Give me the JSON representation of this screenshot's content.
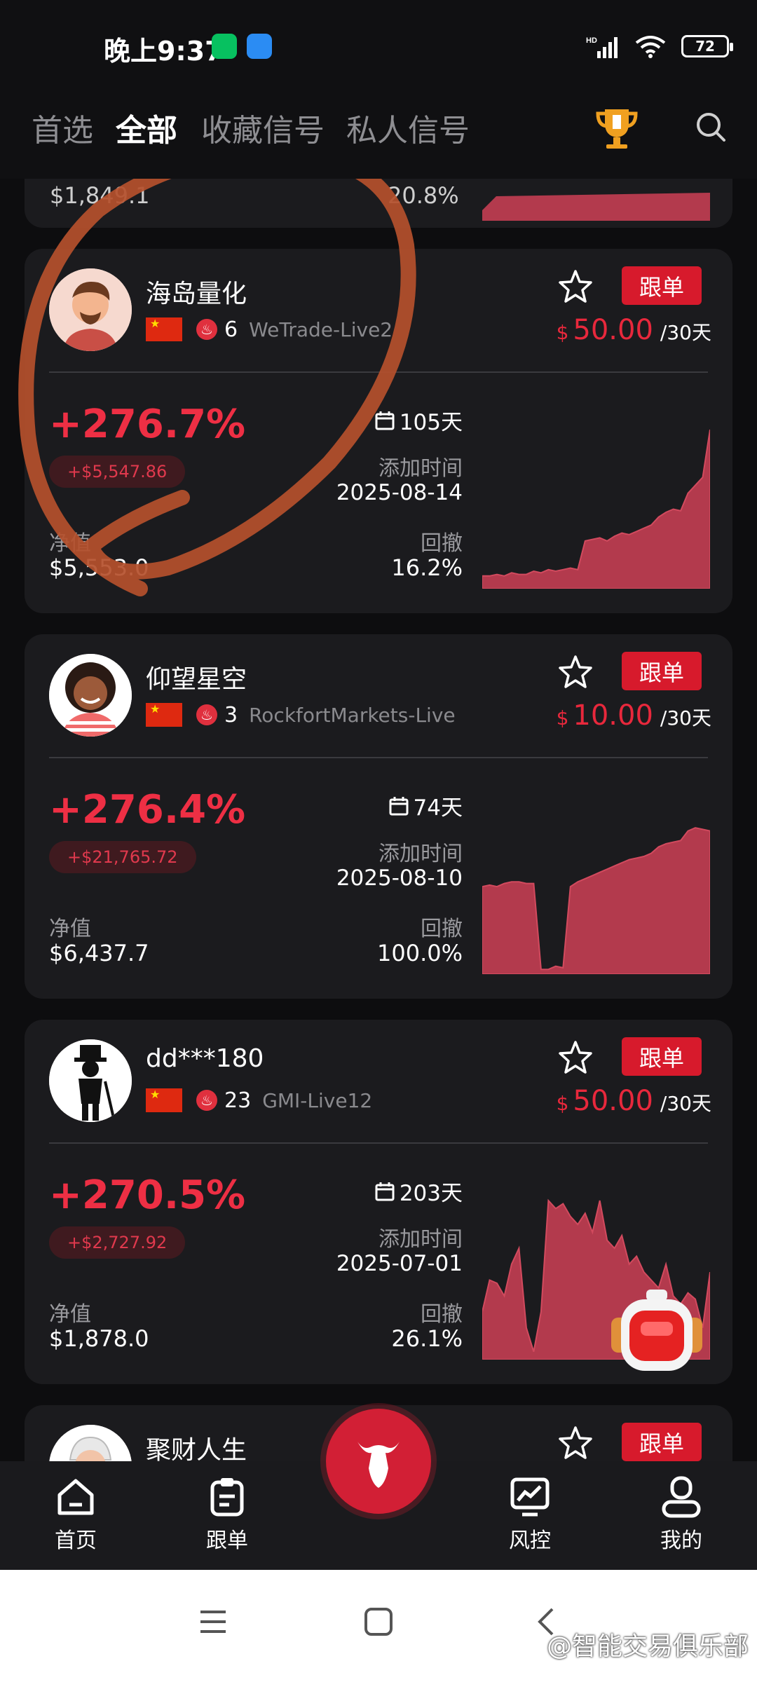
{
  "status_bar": {
    "time": "晚上9:37",
    "battery": "72"
  },
  "tabs": [
    {
      "label": "首选"
    },
    {
      "label": "全部"
    },
    {
      "label": "收藏信号"
    },
    {
      "label": "私人信号"
    }
  ],
  "partial_card": {
    "nav_value": "$1,849.1",
    "drawdown": "20.8%"
  },
  "labels": {
    "add_time": "添加时间",
    "nav": "净值",
    "drawdown": "回撤",
    "follow": "跟单",
    "per_30_days": "/30天",
    "currency": "$"
  },
  "cards": [
    {
      "name": "海岛量化",
      "hot": "6",
      "server": "WeTrade-Live2",
      "price": "50.00",
      "return_pct": "+276.7%",
      "return_usd": "+$5,547.86",
      "days": "105天",
      "add_date": "2025-08-14",
      "nav": "$5,553.0",
      "drawdown": "16.2%",
      "equity_curve": [
        8,
        8,
        9,
        8,
        10,
        9,
        9,
        11,
        10,
        12,
        11,
        12,
        13,
        12,
        30,
        31,
        32,
        30,
        33,
        35,
        34,
        36,
        38,
        40,
        45,
        48,
        50,
        49,
        60,
        65,
        70,
        100
      ]
    },
    {
      "name": "仰望星空",
      "hot": "3",
      "server": "RockfortMarkets-Live",
      "price": "10.00",
      "return_pct": "+276.4%",
      "return_usd": "+$21,765.72",
      "days": "74天",
      "add_date": "2025-08-10",
      "nav": "$6,437.7",
      "drawdown": "100.0%",
      "equity_curve": [
        55,
        56,
        55,
        57,
        58,
        58,
        57,
        57,
        3,
        3,
        5,
        4,
        55,
        58,
        60,
        62,
        64,
        66,
        68,
        70,
        72,
        73,
        74,
        76,
        80,
        82,
        83,
        84,
        90,
        92,
        91,
        90
      ]
    },
    {
      "name": "dd***180",
      "hot": "23",
      "server": "GMI-Live12",
      "price": "50.00",
      "return_pct": "+270.5%",
      "return_usd": "+$2,727.92",
      "days": "203天",
      "add_date": "2025-07-01",
      "nav": "$1,878.0",
      "drawdown": "26.1%",
      "equity_curve": [
        30,
        50,
        48,
        40,
        60,
        70,
        20,
        5,
        30,
        100,
        95,
        98,
        90,
        85,
        92,
        80,
        100,
        75,
        70,
        78,
        60,
        65,
        55,
        50,
        45,
        60,
        40,
        35,
        42,
        38,
        20,
        55
      ]
    },
    {
      "name": "聚财人生"
    }
  ],
  "bottom_nav": [
    {
      "label": "首页"
    },
    {
      "label": "跟单"
    },
    {
      "label": "风控"
    },
    {
      "label": "我的"
    }
  ],
  "watermark": "@智能交易俱乐部",
  "colors": {
    "accent": "#e8283c",
    "card_bg": "#1b1b1e",
    "chart_fill": "#b33a4d",
    "annotation": "#b5502c"
  }
}
